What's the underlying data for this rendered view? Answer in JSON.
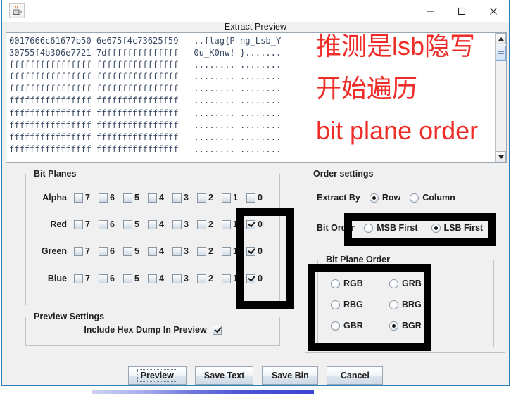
{
  "window": {
    "app_icon": "java-coffee-cup-icon",
    "minimize_label": "minimize-icon",
    "maximize_label": "maximize-icon",
    "close_label": "close-icon",
    "dialog_title": "Extract Preview"
  },
  "preview": {
    "hex_lines": [
      "0017666c61677b50 6e675f4c73625f59   ..flag{P ng_Lsb_Y",
      "30755f4b306e7721 7dffffffffffffff   0u_K0nw! }.......",
      "ffffffffffffffff ffffffffffffffff   ........ ........",
      "ffffffffffffffff ffffffffffffffff   ........ ........",
      "ffffffffffffffff ffffffffffffffff   ........ ........",
      "ffffffffffffffff ffffffffffffffff   ........ ........",
      "ffffffffffffffff ffffffffffffffff   ........ ........",
      "ffffffffffffffff ffffffffffffffff   ........ ........",
      "ffffffffffffffff ffffffffffffffff   ........ ........",
      "ffffffffffffffff ffffffffffffffff   ........ ........"
    ],
    "scroll_up_icon": "scroll-up-arrow-icon",
    "scroll_down_icon": "scroll-down-arrow-icon"
  },
  "annotations": {
    "color": "#ef2d28",
    "line1": "推测是lsb隐写",
    "line2": "开始遍历",
    "line3": "bit plane order"
  },
  "bit_planes": {
    "legend": "Bit Planes",
    "bit_labels": [
      "7",
      "6",
      "5",
      "4",
      "3",
      "2",
      "1",
      "0"
    ],
    "rows": [
      {
        "label": "Alpha",
        "checked": [
          false,
          false,
          false,
          false,
          false,
          false,
          false,
          false
        ]
      },
      {
        "label": "Red",
        "checked": [
          false,
          false,
          false,
          false,
          false,
          false,
          false,
          true
        ]
      },
      {
        "label": "Green",
        "checked": [
          false,
          false,
          false,
          false,
          false,
          false,
          false,
          true
        ]
      },
      {
        "label": "Blue",
        "checked": [
          false,
          false,
          false,
          false,
          false,
          false,
          false,
          true
        ]
      }
    ]
  },
  "order_settings": {
    "legend": "Order settings",
    "extract_by_label": "Extract By",
    "extract_by_options": [
      {
        "label": "Row",
        "selected": true
      },
      {
        "label": "Column",
        "selected": false
      }
    ],
    "bit_order_label": "Bit Order",
    "bit_order_options": [
      {
        "label": "MSB First",
        "selected": false
      },
      {
        "label": "LSB First",
        "selected": true
      }
    ],
    "bit_plane_order_legend": "Bit Plane Order",
    "bit_plane_order_options": [
      {
        "label": "RGB",
        "selected": false
      },
      {
        "label": "GRB",
        "selected": false
      },
      {
        "label": "RBG",
        "selected": false
      },
      {
        "label": "BRG",
        "selected": false
      },
      {
        "label": "GBR",
        "selected": false
      },
      {
        "label": "BGR",
        "selected": true
      }
    ]
  },
  "preview_settings": {
    "legend": "Preview Settings",
    "include_hex_dump_label": "Include Hex Dump In Preview",
    "include_hex_dump_checked": true
  },
  "buttons": [
    {
      "label": "Preview",
      "focused": true
    },
    {
      "label": "Save Text",
      "focused": false
    },
    {
      "label": "Save Bin",
      "focused": false
    },
    {
      "label": "Cancel",
      "focused": false
    }
  ]
}
